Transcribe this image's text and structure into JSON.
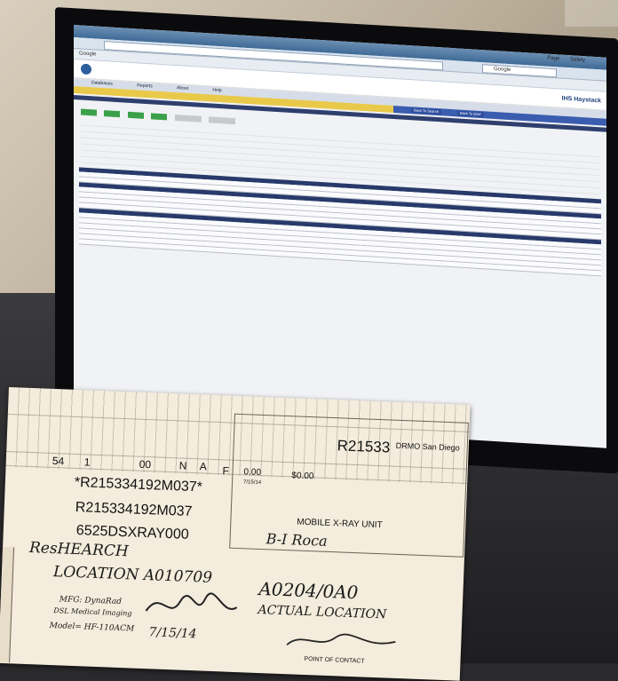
{
  "browser": {
    "search_engine": "Google",
    "tab_google": "Google",
    "toolbar_page": "Page",
    "toolbar_safety": "Safety"
  },
  "app": {
    "brand": "IHS Haystack",
    "menu": [
      "Databases",
      "Reports",
      "About",
      "Help"
    ],
    "nav_buttons": [
      "Back To Search",
      "Back To Brief"
    ]
  },
  "tag": {
    "doc_number": "R21533",
    "location_label": "DRMO San Diego",
    "amount_a": "0.00",
    "amount_b": "$0.00",
    "barcode_text": "*R215334192M037*",
    "requisition": "R215334192M037",
    "nsn": "6525DSXRAY000",
    "item_name": "MOBILE X-RAY UNIT",
    "code_n": "N",
    "code_a": "A",
    "code_f": "F",
    "qty": "00",
    "cond_54": "54",
    "cond_1": "1",
    "date_printed": "7/15/14",
    "footer": "POINT OF CONTACT"
  },
  "handwriting": {
    "research": "ResHEARCH",
    "location": "LOCATION A010709",
    "actual_code": "A0204/0A0",
    "actual_location": "ACTUAL LOCATION",
    "mfg": "MFG: DynaRad",
    "dsl": "DSL Medical Imaging",
    "model": "Model= HF-110ACM",
    "date": "7/15/14",
    "bldg": "B-I Roca"
  }
}
